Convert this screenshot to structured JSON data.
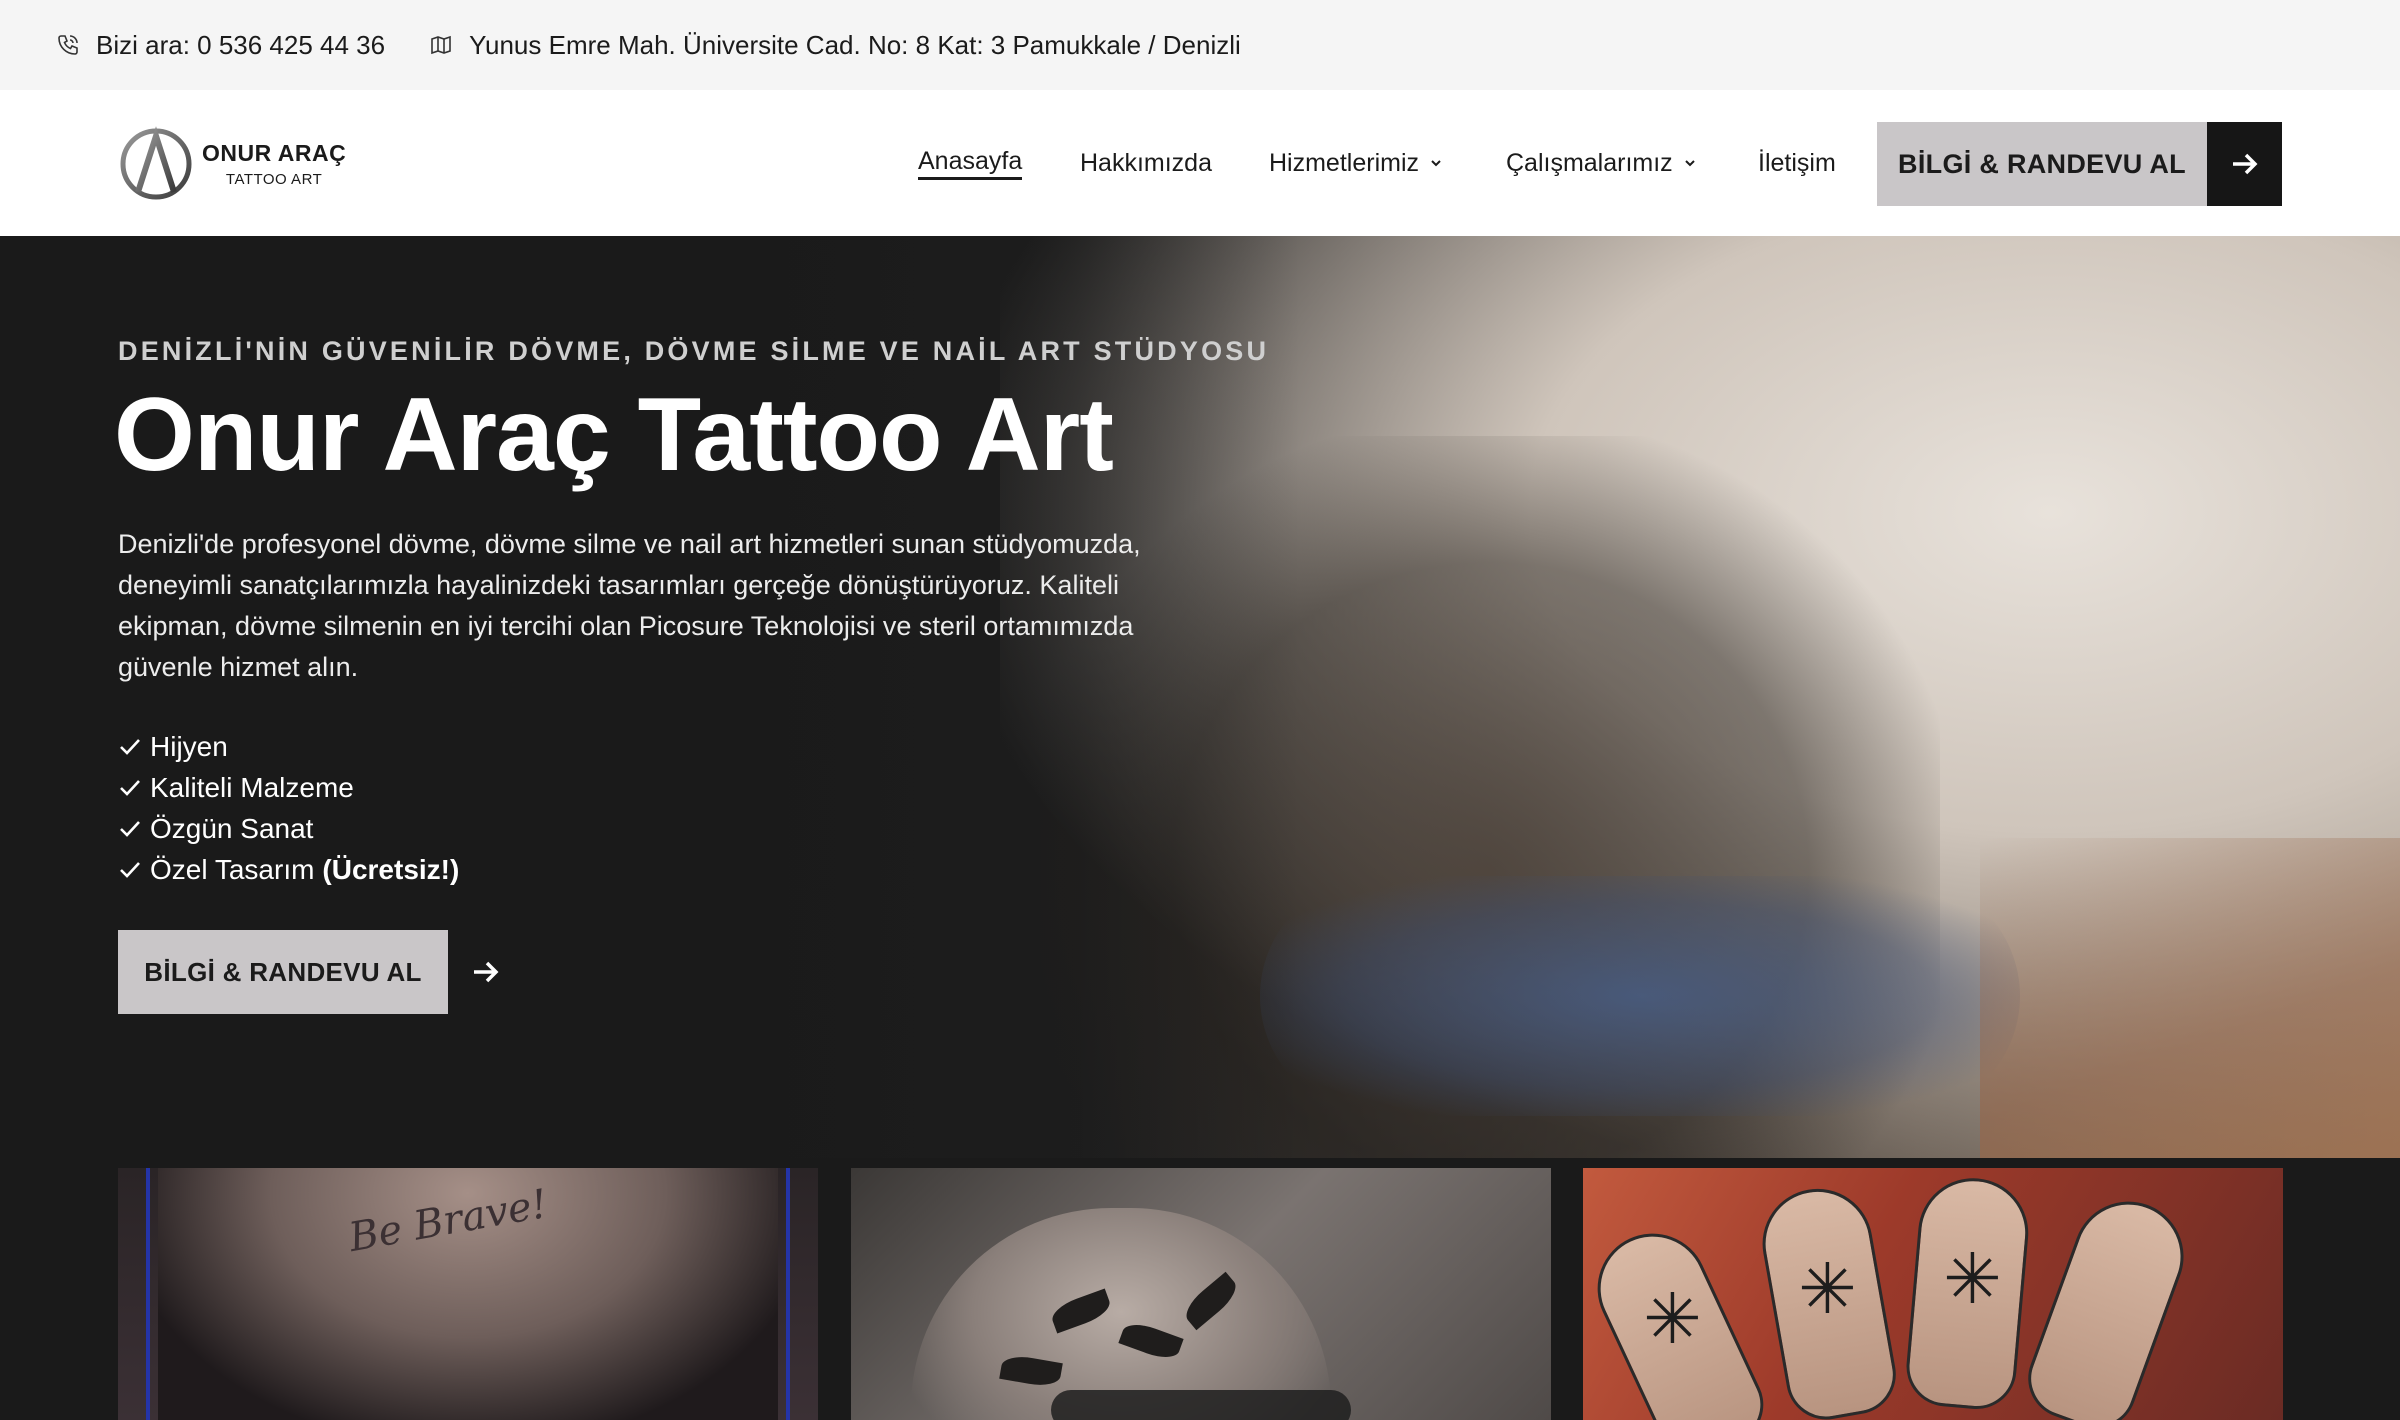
{
  "topbar": {
    "phone_text": "Bizi ara: 0 536 425 44 36",
    "address_text": "Yunus Emre Mah. Üniversite Cad. No: 8 Kat: 3 Pamukkale / Denizli"
  },
  "logo": {
    "name": "ONUR ARAÇ",
    "subtitle": "TATTOO ART"
  },
  "nav": {
    "items": [
      {
        "label": "Anasayfa",
        "active": true,
        "dropdown": false
      },
      {
        "label": "Hakkımızda",
        "active": false,
        "dropdown": false
      },
      {
        "label": "Hizmetlerimiz",
        "active": false,
        "dropdown": true
      },
      {
        "label": "Çalışmalarımız",
        "active": false,
        "dropdown": true
      },
      {
        "label": "İletişim",
        "active": false,
        "dropdown": false
      }
    ],
    "cta_label": "BİLGİ & RANDEVU AL"
  },
  "hero": {
    "eyebrow": "DENİZLİ'NİN GÜVENİLİR DÖVME, DÖVME SİLME VE NAİL ART STÜDYOSU",
    "title": "Onur Araç Tattoo Art",
    "description": "Denizli'de profesyonel dövme, dövme silme ve nail art hizmetleri sunan stüdyomuzda, deneyimli sanatçılarımızla hayalinizdeki tasarımları gerçeğe dönüştürüyoruz. Kaliteli ekipman, dövme silmenin en iyi tercihi olan Picosure Teknolojisi ve steril ortamımızda güvenle hizmet alın.",
    "checklist": [
      {
        "text": "Hijyen",
        "bold": ""
      },
      {
        "text": "Kaliteli Malzeme",
        "bold": ""
      },
      {
        "text": "Özgün Sanat",
        "bold": ""
      },
      {
        "text": "Özel Tasarım",
        "bold": "(Ücretsiz!)"
      }
    ],
    "cta_label": "BİLGİ & RANDEVU AL"
  },
  "gallery": {
    "card1_script": "Be Brave!"
  },
  "colors": {
    "topbar_bg": "#f5f5f5",
    "header_bg": "#ffffff",
    "hero_bg": "#1a1a1a",
    "cta_bg": "#c9c6c8",
    "cta_arrow_bg": "#161616"
  }
}
